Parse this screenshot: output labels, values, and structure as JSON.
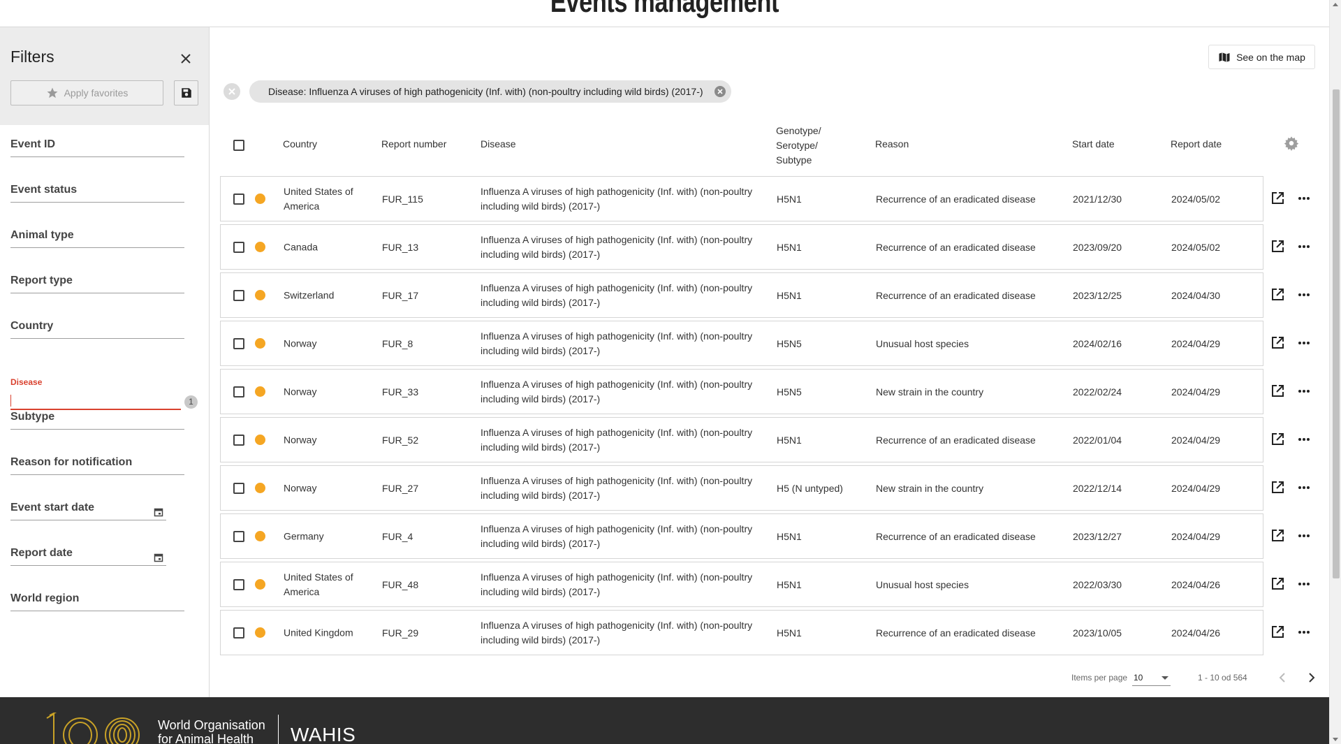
{
  "page": {
    "title": "Events management"
  },
  "filters": {
    "title": "Filters",
    "apply_favorites_label": "Apply favorites",
    "fields": [
      {
        "name": "filter-event-id",
        "label": "Event ID"
      },
      {
        "name": "filter-event-status",
        "label": "Event status"
      },
      {
        "name": "filter-animal-type",
        "label": "Animal type"
      },
      {
        "name": "filter-report-type",
        "label": "Report type"
      },
      {
        "name": "filter-country",
        "label": "Country"
      }
    ],
    "disease": {
      "label": "Disease",
      "value": "",
      "count": "1"
    },
    "fields_after": [
      {
        "name": "filter-subtype",
        "label": "Subtype"
      },
      {
        "name": "filter-reason",
        "label": "Reason for notification"
      }
    ],
    "event_start_date": "Event start date",
    "report_date": "Report date",
    "world_region": "World region"
  },
  "toolbar": {
    "see_on_map_label": "See on the map"
  },
  "active_filter_chip": "Disease: Influenza A viruses of high pathogenicity (Inf. with) (non-poultry including wild birds) (2017-)",
  "table": {
    "headers": {
      "country": "Country",
      "report_number": "Report number",
      "disease": "Disease",
      "genotype": [
        "Genotype/",
        "Serotype/",
        "Subtype"
      ],
      "reason": "Reason",
      "start_date": "Start date",
      "report_date": "Report date"
    },
    "status_color": "#f5a623",
    "rows": [
      {
        "country": "United States of America",
        "report": "FUR_115",
        "disease": "Influenza A viruses of high pathogenicity (Inf. with) (non-poultry including wild birds) (2017-)",
        "genotype": "H5N1",
        "reason": "Recurrence of an eradicated disease",
        "start": "2021/12/30",
        "report_date": "2024/05/02"
      },
      {
        "country": "Canada",
        "report": "FUR_13",
        "disease": "Influenza A viruses of high pathogenicity (Inf. with) (non-poultry including wild birds) (2017-)",
        "genotype": "H5N1",
        "reason": "Recurrence of an eradicated disease",
        "start": "2023/09/20",
        "report_date": "2024/05/02"
      },
      {
        "country": "Switzerland",
        "report": "FUR_17",
        "disease": "Influenza A viruses of high pathogenicity (Inf. with) (non-poultry including wild birds) (2017-)",
        "genotype": "H5N1",
        "reason": "Recurrence of an eradicated disease",
        "start": "2023/12/25",
        "report_date": "2024/04/30"
      },
      {
        "country": "Norway",
        "report": "FUR_8",
        "disease": "Influenza A viruses of high pathogenicity (Inf. with) (non-poultry including wild birds) (2017-)",
        "genotype": "H5N5",
        "reason": "Unusual host species",
        "start": "2024/02/16",
        "report_date": "2024/04/29"
      },
      {
        "country": "Norway",
        "report": "FUR_33",
        "disease": "Influenza A viruses of high pathogenicity (Inf. with) (non-poultry including wild birds) (2017-)",
        "genotype": "H5N5",
        "reason": "New strain in the country",
        "start": "2022/02/24",
        "report_date": "2024/04/29"
      },
      {
        "country": "Norway",
        "report": "FUR_52",
        "disease": "Influenza A viruses of high pathogenicity (Inf. with) (non-poultry including wild birds) (2017-)",
        "genotype": "H5N1",
        "reason": "Recurrence of an eradicated disease",
        "start": "2022/01/04",
        "report_date": "2024/04/29"
      },
      {
        "country": "Norway",
        "report": "FUR_27",
        "disease": "Influenza A viruses of high pathogenicity (Inf. with) (non-poultry including wild birds) (2017-)",
        "genotype": "H5 (N untyped)",
        "reason": "New strain in the country",
        "start": "2022/12/14",
        "report_date": "2024/04/29"
      },
      {
        "country": "Germany",
        "report": "FUR_4",
        "disease": "Influenza A viruses of high pathogenicity (Inf. with) (non-poultry including wild birds) (2017-)",
        "genotype": "H5N1",
        "reason": "Recurrence of an eradicated disease",
        "start": "2023/12/27",
        "report_date": "2024/04/29"
      },
      {
        "country": "United States of America",
        "report": "FUR_48",
        "disease": "Influenza A viruses of high pathogenicity (Inf. with) (non-poultry including wild birds) (2017-)",
        "genotype": "H5N1",
        "reason": "Unusual host species",
        "start": "2022/03/30",
        "report_date": "2024/04/26"
      },
      {
        "country": "United Kingdom",
        "report": "FUR_29",
        "disease": "Influenza A viruses of high pathogenicity (Inf. with) (non-poultry including wild birds) (2017-)",
        "genotype": "H5N1",
        "reason": "Recurrence of an eradicated disease",
        "start": "2023/10/05",
        "report_date": "2024/04/26"
      }
    ]
  },
  "paginator": {
    "items_per_page_label": "Items per page",
    "items_per_page": "10",
    "range": "1 - 10 od 564"
  },
  "footer": {
    "org_line1": "World Organisation",
    "org_line2": "for Animal Health",
    "app_name": "WAHIS",
    "brand_color": "#c9a227"
  },
  "icons": [
    "close-icon",
    "star-icon",
    "save-icon",
    "map-icon",
    "clear-icon",
    "calendar-icon",
    "settings-icon",
    "open-external-icon",
    "more-icon",
    "chevron-left-icon",
    "chevron-right-icon"
  ]
}
